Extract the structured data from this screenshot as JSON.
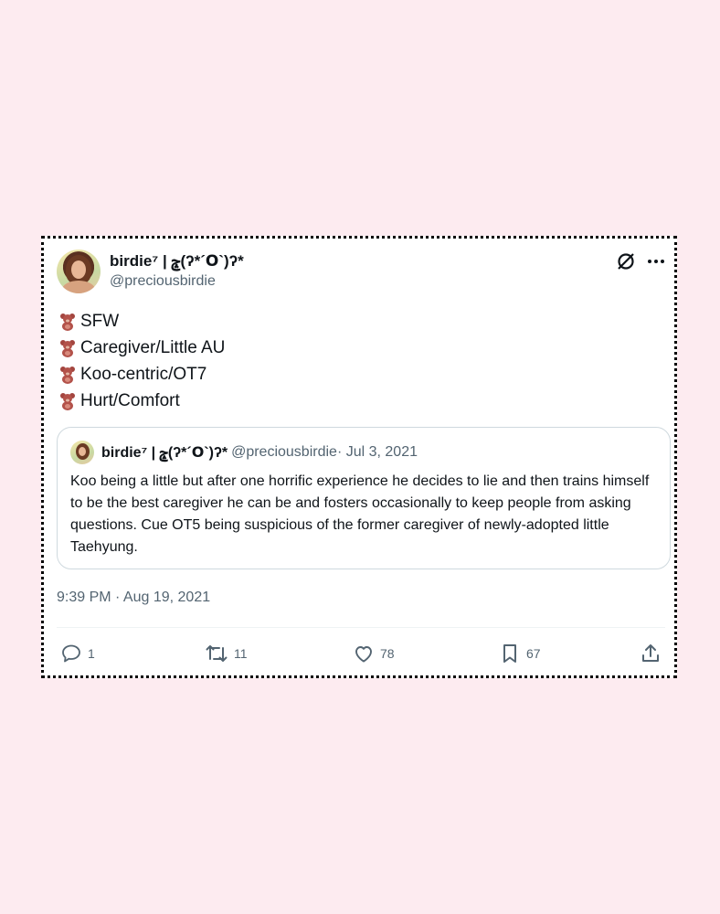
{
  "tweet": {
    "display_name": "birdie⁷ | ݘ(ʔ*´ꓳ`)ʔ*",
    "handle": "@preciousbirdie",
    "lines": [
      "SFW",
      "Caregiver/Little AU",
      "Koo-centric/OT7",
      "Hurt/Comfort"
    ],
    "bullet_icon": "teddy-bear-emoji",
    "timestamp": "9:39 PM · Aug 19, 2021"
  },
  "quote": {
    "display_name": "birdie⁷ | ݘ(ʔ*´ꓳ`)ʔ*",
    "handle": "@preciousbirdie",
    "date": " · Jul 3, 2021",
    "text": "Koo being a little but after one horrific experience he decides to lie and then trains himself to be the best caregiver he can be and fosters occasionally to keep people from asking questions. Cue OT5 being suspicious of the former caregiver of newly-adopted little Taehyung."
  },
  "actions": {
    "replies": "1",
    "retweets": "11",
    "likes": "78",
    "bookmarks": "67"
  },
  "colors": {
    "page_background": "#fdebf0",
    "text": "#0f1419",
    "muted": "#536471",
    "border": "#cfd9de"
  }
}
